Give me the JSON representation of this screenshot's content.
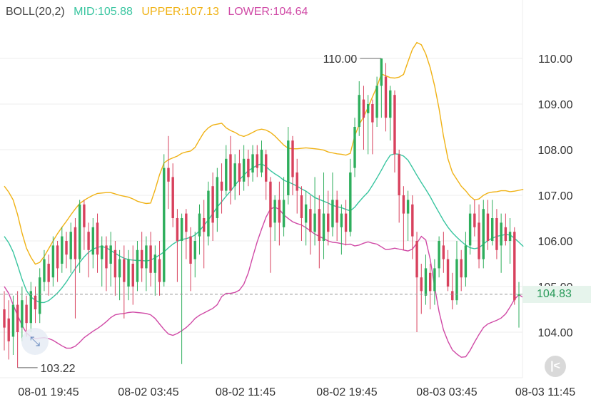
{
  "indicator": {
    "name": "BOLL(20,2)",
    "mid_label": "MID:",
    "mid_value": "105.88",
    "upper_label": "UPPER:",
    "upper_value": "107.13",
    "lower_label": "LOWER:",
    "lower_value": "104.64"
  },
  "colors": {
    "up": "#2eae5c",
    "down": "#d8415d",
    "mid": "#39c5a0",
    "upper": "#f0b215",
    "lower": "#d04aa6",
    "grid": "#eeeeee",
    "text": "#333333"
  },
  "price_tag": "104.83",
  "reset_icon": "collapse-left-icon",
  "fullscreen_icon": "expand-arrows-icon",
  "chart_data": {
    "type": "candlestick",
    "ylim": [
      103.0,
      110.55
    ],
    "y_ticks": [
      "110.00",
      "109.00",
      "108.00",
      "107.00",
      "106.00",
      "105.00",
      "104.00"
    ],
    "x_ticks": [
      "08-01 19:45",
      "08-02 03:45",
      "08-02 11:45",
      "08-02 19:45",
      "08-03 03:45",
      "08-03 11:45"
    ],
    "current_price": 104.83,
    "max_label": "110.00",
    "min_label": "103.22",
    "candles": [
      [
        104.5,
        104.1,
        104.9,
        103.6
      ],
      [
        104.3,
        103.8,
        104.7,
        103.4
      ],
      [
        103.9,
        104.6,
        104.8,
        103.5
      ],
      [
        104.6,
        104.0,
        104.9,
        103.22
      ],
      [
        104.1,
        104.7,
        105.0,
        103.8
      ],
      [
        104.6,
        104.2,
        104.8,
        103.9
      ],
      [
        104.2,
        104.9,
        105.1,
        104.0
      ],
      [
        104.8,
        104.5,
        105.0,
        104.2
      ],
      [
        104.4,
        105.2,
        105.4,
        104.2
      ],
      [
        105.1,
        105.6,
        105.8,
        104.9
      ],
      [
        105.5,
        105.1,
        105.7,
        104.8
      ],
      [
        105.2,
        105.9,
        106.1,
        105.0
      ],
      [
        105.9,
        105.4,
        106.0,
        105.1
      ],
      [
        105.5,
        106.1,
        106.3,
        105.3
      ],
      [
        106.0,
        105.7,
        106.2,
        105.4
      ],
      [
        105.6,
        106.2,
        106.4,
        105.3
      ],
      [
        106.3,
        105.6,
        106.5,
        104.3
      ],
      [
        105.6,
        106.8,
        106.9,
        105.3
      ],
      [
        106.8,
        106.3,
        106.9,
        105.8
      ],
      [
        106.2,
        105.8,
        106.4,
        105.2
      ],
      [
        105.7,
        106.3,
        106.5,
        105.4
      ],
      [
        106.4,
        105.7,
        106.6,
        105.3
      ],
      [
        105.6,
        105.9,
        106.1,
        105.0
      ],
      [
        105.9,
        105.4,
        106.1,
        104.9
      ],
      [
        105.5,
        105.9,
        106.2,
        105.0
      ],
      [
        105.8,
        105.2,
        106.0,
        104.8
      ],
      [
        105.2,
        105.6,
        105.8,
        104.7
      ],
      [
        105.6,
        105.1,
        105.9,
        104.3
      ],
      [
        105.0,
        105.6,
        105.8,
        104.7
      ],
      [
        105.5,
        105.0,
        105.9,
        104.6
      ],
      [
        105.1,
        105.8,
        106.0,
        104.9
      ],
      [
        105.8,
        105.4,
        106.2,
        105.1
      ],
      [
        105.4,
        105.9,
        106.1,
        104.9
      ],
      [
        105.9,
        105.3,
        106.2,
        105.0
      ],
      [
        105.3,
        105.7,
        105.9,
        104.8
      ],
      [
        105.6,
        105.1,
        106.0,
        104.8
      ],
      [
        105.1,
        107.6,
        107.9,
        105.0
      ],
      [
        107.6,
        107.3,
        108.3,
        106.7
      ],
      [
        107.4,
        106.5,
        107.7,
        106.3
      ],
      [
        106.5,
        106.0,
        106.7,
        105.1
      ],
      [
        106.0,
        106.5,
        106.6,
        103.3
      ],
      [
        106.6,
        106.2,
        106.7,
        105.6
      ],
      [
        106.1,
        105.5,
        106.3,
        104.9
      ],
      [
        105.6,
        106.0,
        106.2,
        105.2
      ],
      [
        106.1,
        106.6,
        106.8,
        105.7
      ],
      [
        106.5,
        106.2,
        106.9,
        105.4
      ],
      [
        106.1,
        107.1,
        107.3,
        105.9
      ],
      [
        107.2,
        106.4,
        107.5,
        106.0
      ],
      [
        106.5,
        107.4,
        107.6,
        106.2
      ],
      [
        107.3,
        107.1,
        107.7,
        106.6
      ],
      [
        107.1,
        107.8,
        108.1,
        107.0
      ],
      [
        107.9,
        107.1,
        108.3,
        106.8
      ],
      [
        107.2,
        107.7,
        107.9,
        106.9
      ],
      [
        107.7,
        107.3,
        108.0,
        107.0
      ],
      [
        107.3,
        107.8,
        108.1,
        107.1
      ],
      [
        107.8,
        107.4,
        108.0,
        107.2
      ],
      [
        107.5,
        107.9,
        108.1,
        107.3
      ],
      [
        107.9,
        107.6,
        108.1,
        107.4
      ],
      [
        107.5,
        108.0,
        108.2,
        107.4
      ],
      [
        107.9,
        107.3,
        108.0,
        106.9
      ],
      [
        107.3,
        106.3,
        107.4,
        105.3
      ],
      [
        106.4,
        106.9,
        107.0,
        106.0
      ],
      [
        106.9,
        106.4,
        107.3,
        105.9
      ],
      [
        106.3,
        106.9,
        107.4,
        106.1
      ],
      [
        107.0,
        108.2,
        108.5,
        106.8
      ],
      [
        108.2,
        107.4,
        108.3,
        107.0
      ],
      [
        107.5,
        107.1,
        107.8,
        106.6
      ],
      [
        107.0,
        106.5,
        107.2,
        106.0
      ],
      [
        106.4,
        106.8,
        107.1,
        105.9
      ],
      [
        106.7,
        106.2,
        107.0,
        105.7
      ],
      [
        106.2,
        106.6,
        107.4,
        105.9
      ],
      [
        106.7,
        106.0,
        107.0,
        105.4
      ],
      [
        106.0,
        106.6,
        107.5,
        105.6
      ],
      [
        106.6,
        106.2,
        107.1,
        105.9
      ],
      [
        106.3,
        106.9,
        107.5,
        106.1
      ],
      [
        106.9,
        106.4,
        107.1,
        106.0
      ],
      [
        106.3,
        106.6,
        106.8,
        105.7
      ],
      [
        106.6,
        106.2,
        106.9,
        105.9
      ],
      [
        106.2,
        107.5,
        107.8,
        106.1
      ],
      [
        107.6,
        108.5,
        108.7,
        107.4
      ],
      [
        108.5,
        109.2,
        109.5,
        108.3
      ],
      [
        109.1,
        108.7,
        109.4,
        108.0
      ],
      [
        108.8,
        109.0,
        109.2,
        107.9
      ],
      [
        109.0,
        108.6,
        109.1,
        107.9
      ],
      [
        108.7,
        109.4,
        109.6,
        108.5
      ],
      [
        109.4,
        110.0,
        110.0,
        108.7
      ],
      [
        109.6,
        108.7,
        109.9,
        108.4
      ],
      [
        108.7,
        109.3,
        109.4,
        108.2
      ],
      [
        109.2,
        107.9,
        109.3,
        107.5
      ],
      [
        107.9,
        107.0,
        108.0,
        106.4
      ],
      [
        107.0,
        106.6,
        107.2,
        105.8
      ],
      [
        106.6,
        106.9,
        107.1,
        106.0
      ],
      [
        106.8,
        106.1,
        107.0,
        105.6
      ],
      [
        106.0,
        105.2,
        106.2,
        104.0
      ],
      [
        105.2,
        104.9,
        105.5,
        104.4
      ],
      [
        104.8,
        105.4,
        105.7,
        104.6
      ],
      [
        105.3,
        104.9,
        105.5,
        104.5
      ],
      [
        104.9,
        105.4,
        105.6,
        104.6
      ],
      [
        105.4,
        106.0,
        106.1,
        105.2
      ],
      [
        105.9,
        105.6,
        106.2,
        105.3
      ],
      [
        105.6,
        105.0,
        105.8,
        104.9
      ],
      [
        104.9,
        104.7,
        105.3,
        104.5
      ],
      [
        104.7,
        105.6,
        106.0,
        104.6
      ],
      [
        105.6,
        105.2,
        105.8,
        104.9
      ],
      [
        105.2,
        105.9,
        106.2,
        105.0
      ],
      [
        105.9,
        106.6,
        106.8,
        105.7
      ],
      [
        106.6,
        106.3,
        106.9,
        106.1
      ],
      [
        106.4,
        105.6,
        106.8,
        105.4
      ],
      [
        105.6,
        106.7,
        106.9,
        105.4
      ],
      [
        106.6,
        106.0,
        106.9,
        105.8
      ],
      [
        106.0,
        106.5,
        106.9,
        105.9
      ],
      [
        106.5,
        105.8,
        106.7,
        105.6
      ],
      [
        105.9,
        106.4,
        106.6,
        105.3
      ],
      [
        106.3,
        106.0,
        106.6,
        105.9
      ],
      [
        106.0,
        106.2,
        106.5,
        105.5
      ],
      [
        106.2,
        104.7,
        106.3,
        104.6
      ],
      [
        104.8,
        104.83,
        105.1,
        104.1
      ]
    ],
    "series": [
      {
        "name": "MID",
        "values": [
          106.1,
          105.96,
          105.76,
          105.47,
          105.16,
          104.91,
          104.77,
          104.7,
          104.65,
          104.65,
          104.69,
          104.77,
          104.86,
          104.97,
          105.1,
          105.25,
          105.39,
          105.53,
          105.65,
          105.75,
          105.82,
          105.86,
          105.88,
          105.85,
          105.79,
          105.73,
          105.67,
          105.62,
          105.59,
          105.58,
          105.57,
          105.57,
          105.56,
          105.58,
          105.63,
          105.69,
          105.76,
          105.85,
          105.93,
          105.99,
          106.03,
          106.05,
          106.08,
          106.13,
          106.22,
          106.34,
          106.46,
          106.6,
          106.74,
          106.86,
          106.98,
          107.09,
          107.22,
          107.34,
          107.44,
          107.54,
          107.6,
          107.66,
          107.69,
          107.63,
          107.54,
          107.47,
          107.41,
          107.33,
          107.29,
          107.25,
          107.2,
          107.14,
          107.09,
          107.02,
          106.95,
          106.91,
          106.87,
          106.83,
          106.78,
          106.75,
          106.73,
          106.69,
          106.66,
          106.74,
          106.86,
          106.97,
          107.07,
          107.22,
          107.38,
          107.55,
          107.73,
          107.88,
          107.91,
          107.9,
          107.86,
          107.77,
          107.61,
          107.44,
          107.28,
          107.13,
          106.97,
          106.79,
          106.62,
          106.45,
          106.3,
          106.18,
          106.08,
          105.99,
          105.91,
          105.85,
          105.83,
          105.85,
          105.93,
          106.01,
          106.06,
          106.1,
          106.12,
          106.14,
          106.13,
          106.06,
          105.97,
          105.88
        ]
      },
      {
        "name": "UPPER",
        "values": [
          107.2,
          107.07,
          106.9,
          106.58,
          106.17,
          105.84,
          105.64,
          105.49,
          105.53,
          105.66,
          105.83,
          106.0,
          106.16,
          106.3,
          106.43,
          106.57,
          106.7,
          106.82,
          106.89,
          106.95,
          107.0,
          107.04,
          107.05,
          107.06,
          107.06,
          107.03,
          107.0,
          106.98,
          106.96,
          106.92,
          106.87,
          106.84,
          106.82,
          106.83,
          107.12,
          107.45,
          107.71,
          107.78,
          107.82,
          107.86,
          107.92,
          107.95,
          107.97,
          108.05,
          108.22,
          108.38,
          108.48,
          108.54,
          108.56,
          108.58,
          108.48,
          108.42,
          108.38,
          108.32,
          108.29,
          108.33,
          108.38,
          108.43,
          108.45,
          108.43,
          108.38,
          108.3,
          108.2,
          108.1,
          108.03,
          108.02,
          108.02,
          108.03,
          108.04,
          108.03,
          108.02,
          108.01,
          107.99,
          107.95,
          107.93,
          107.91,
          107.9,
          107.88,
          107.92,
          108.3,
          108.55,
          108.72,
          108.93,
          109.16,
          109.38,
          109.66,
          109.62,
          109.58,
          109.57,
          109.59,
          109.65,
          109.93,
          110.2,
          110.35,
          110.3,
          110.1,
          109.8,
          109.4,
          108.9,
          108.3,
          107.8,
          107.5,
          107.35,
          107.2,
          107.1,
          106.98,
          106.9,
          106.92,
          107.0,
          107.05,
          107.07,
          107.08,
          107.1,
          107.1,
          107.08,
          107.09,
          107.11,
          107.13
        ]
      },
      {
        "name": "LOWER",
        "values": [
          105.0,
          104.85,
          104.6,
          104.37,
          104.15,
          103.98,
          103.9,
          103.86,
          103.87,
          103.88,
          103.86,
          103.82,
          103.76,
          103.7,
          103.65,
          103.65,
          103.69,
          103.78,
          103.88,
          103.95,
          104.02,
          104.08,
          104.15,
          104.23,
          104.32,
          104.38,
          104.4,
          104.41,
          104.43,
          104.44,
          104.43,
          104.42,
          104.41,
          104.38,
          104.3,
          104.18,
          104.06,
          103.96,
          103.93,
          103.97,
          104.03,
          104.1,
          104.19,
          104.3,
          104.37,
          104.42,
          104.47,
          104.52,
          104.6,
          104.78,
          104.85,
          104.85,
          104.87,
          104.92,
          105.05,
          105.3,
          105.65,
          105.98,
          106.26,
          106.52,
          106.7,
          106.74,
          106.69,
          106.57,
          106.49,
          106.42,
          106.38,
          106.35,
          106.29,
          106.22,
          106.15,
          106.1,
          106.05,
          106.0,
          105.97,
          105.96,
          105.94,
          105.92,
          105.93,
          105.89,
          105.91,
          105.95,
          105.98,
          105.95,
          105.93,
          105.87,
          105.81,
          105.82,
          105.84,
          105.82,
          105.8,
          105.78,
          105.82,
          105.95,
          106.1,
          106.02,
          105.6,
          105.0,
          104.45,
          104.05,
          103.8,
          103.61,
          103.52,
          103.45,
          103.46,
          103.6,
          103.78,
          103.95,
          104.1,
          104.18,
          104.22,
          104.26,
          104.31,
          104.4,
          104.55,
          104.72,
          104.82,
          104.76
        ]
      }
    ]
  }
}
